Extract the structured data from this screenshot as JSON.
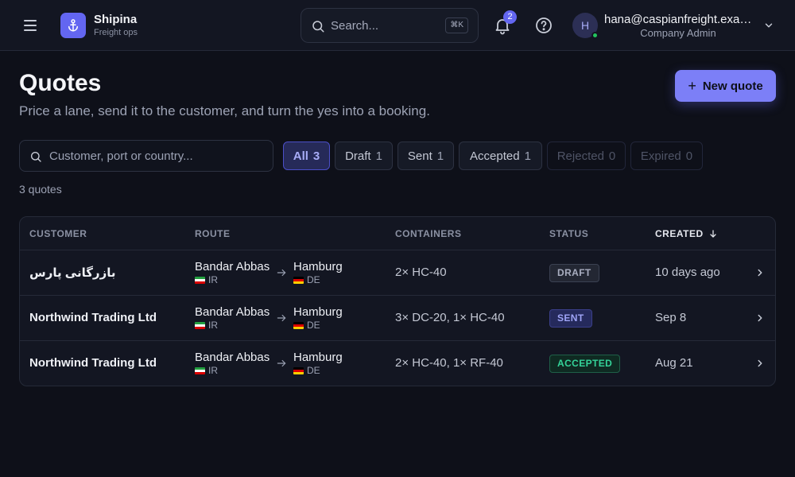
{
  "app": {
    "name": "Shipina",
    "subtitle": "Freight ops"
  },
  "topbar": {
    "search_placeholder": "Search...",
    "search_shortcut": "⌘K",
    "notification_count": "2",
    "user": {
      "initial": "H",
      "email": "hana@caspianfreight.example",
      "role": "Company Admin",
      "online": true
    },
    "icons": [
      "menu-icon",
      "anchor-icon",
      "search-icon",
      "bell-icon",
      "help-icon",
      "chevron-down-icon"
    ]
  },
  "page": {
    "title": "Quotes",
    "subtitle": "Price a lane, send it to the customer, and turn the yes into a booking.",
    "new_button_label": "New quote"
  },
  "filters": {
    "search_placeholder": "Customer, port or country...",
    "chips": [
      {
        "label": "All",
        "count": "3",
        "state": "active"
      },
      {
        "label": "Draft",
        "count": "1",
        "state": "normal"
      },
      {
        "label": "Sent",
        "count": "1",
        "state": "normal"
      },
      {
        "label": "Accepted",
        "count": "1",
        "state": "normal"
      },
      {
        "label": "Rejected",
        "count": "0",
        "state": "disabled"
      },
      {
        "label": "Expired",
        "count": "0",
        "state": "disabled"
      }
    ],
    "result_count": "3 quotes"
  },
  "table": {
    "columns": [
      "CUSTOMER",
      "ROUTE",
      "CONTAINERS",
      "STATUS",
      "CREATED"
    ],
    "sorted_column": "CREATED",
    "sort_direction": "descending",
    "rows": [
      {
        "customer": "بازرگانی پارس",
        "from_port": "Bandar Abbas",
        "from_country": "IR",
        "to_port": "Hamburg",
        "to_country": "DE",
        "containers": "2× HC-40",
        "status": "DRAFT",
        "created": "10 days ago"
      },
      {
        "customer": "Northwind Trading Ltd",
        "from_port": "Bandar Abbas",
        "from_country": "IR",
        "to_port": "Hamburg",
        "to_country": "DE",
        "containers": "3× DC-20, 1× HC-40",
        "status": "SENT",
        "created": "Sep 8"
      },
      {
        "customer": "Northwind Trading Ltd",
        "from_port": "Bandar Abbas",
        "from_country": "IR",
        "to_port": "Hamburg",
        "to_country": "DE",
        "containers": "2× HC-40, 1× RF-40",
        "status": "ACCEPTED",
        "created": "Aug 21"
      }
    ]
  },
  "colors": {
    "background": "#0e1019",
    "accent": "#6366f1",
    "status_draft": "#a9aec0",
    "status_sent": "#9fa4f6",
    "status_accepted": "#34d399"
  }
}
